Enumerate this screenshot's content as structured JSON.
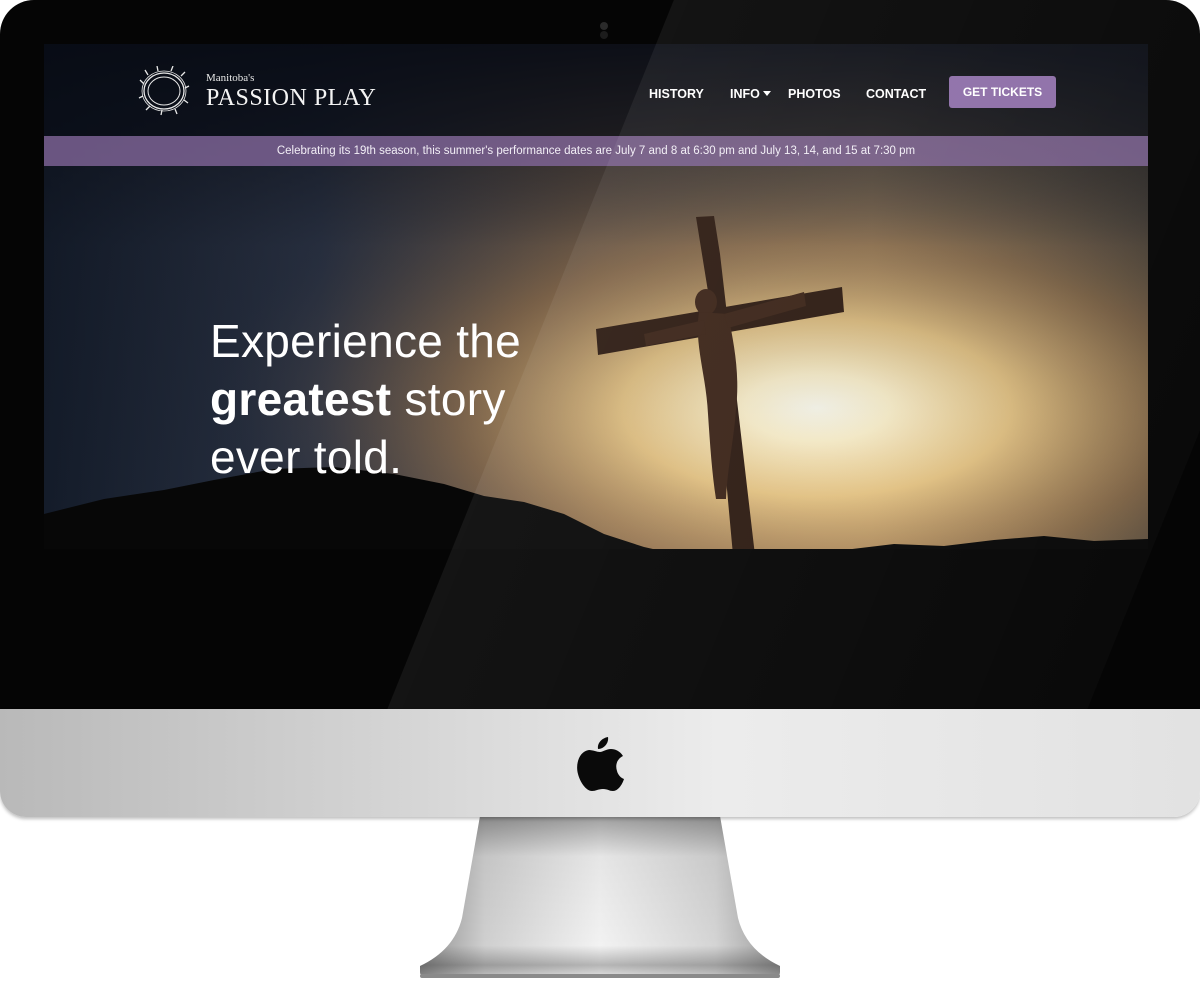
{
  "logo": {
    "small": "Manitoba's",
    "big": "PASSION PLAY"
  },
  "nav": {
    "items": [
      {
        "label": "HISTORY"
      },
      {
        "label": "INFO"
      },
      {
        "label": "PHOTOS"
      },
      {
        "label": "CONTACT"
      }
    ],
    "cta_label": "GET TICKETS"
  },
  "announcement": "Celebrating its 19th season, this summer's performance dates are July 7 and 8 at 6:30 pm and July 13, 14, and 15 at 7:30 pm",
  "hero": {
    "line1": "Experience the",
    "line2_bold": "greatest",
    "line2_rest": " story",
    "line3": "ever told."
  },
  "colors": {
    "accent": "#8e6fa8",
    "announcement_bg": "#84689c",
    "header_bg": "#080b14"
  },
  "icons": {
    "logo": "crown-of-thorns-icon",
    "dropdown": "caret-down-icon",
    "device": "apple-logo-icon"
  }
}
